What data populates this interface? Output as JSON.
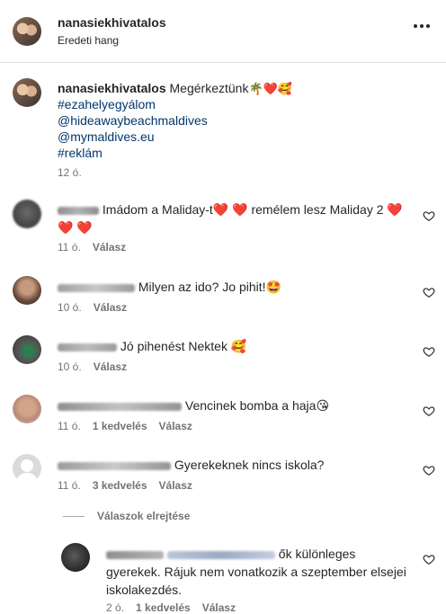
{
  "header": {
    "username": "nanasiekhivatalos",
    "audio": "Eredeti hang"
  },
  "caption": {
    "username": "nanasiekhivatalos",
    "text": "Megérkeztünk",
    "emojis": "🌴❤️🥰",
    "lines": [
      "#ezahelyegyálom",
      "@hideawaybeachmaldives",
      "@mymaldives.eu",
      "#reklám"
    ],
    "time": "12 ó."
  },
  "comments": [
    {
      "text": "Imádom a Maliday-t❤️ ❤️ remélem lesz Maliday 2 ❤️",
      "text2": "❤️ ❤️",
      "time": "11 ó.",
      "reply": "Válasz"
    },
    {
      "text": "Milyen az ido? Jo pihit!🤩",
      "time": "10 ó.",
      "reply": "Válasz"
    },
    {
      "text": "Jó pihenést Nektek 🥰",
      "time": "10 ó.",
      "reply": "Válasz"
    },
    {
      "text": "Vencinek bomba a haja😘",
      "time": "11 ó.",
      "likes": "1 kedvelés",
      "reply": "Válasz"
    },
    {
      "text": "Gyerekeknek nincs iskola?",
      "time": "11 ó.",
      "likes": "3 kedvelés",
      "reply": "Válasz"
    }
  ],
  "hide_replies": "Válaszok elrejtése",
  "reply_comment": {
    "text1": "ők különleges",
    "text2": "gyerekek. Rájuk nem vonatkozik a szeptember elsejei",
    "text3": "iskolakezdés.",
    "time": "2 ó.",
    "likes": "1 kedvelés",
    "reply": "Válasz"
  },
  "icons": {
    "more": "more-options-icon",
    "like": "heart-outline-icon"
  }
}
